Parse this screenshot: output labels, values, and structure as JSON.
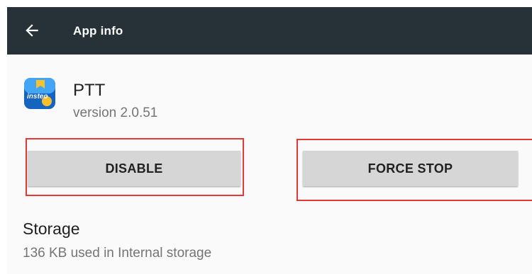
{
  "toolbar": {
    "back_icon": "arrow-left-icon",
    "title": "App info",
    "background": "#263238"
  },
  "app": {
    "icon": "ptt-app-icon",
    "icon_text": "insteo",
    "name": "PTT",
    "version": "version 2.0.51"
  },
  "actions": {
    "disable_label": "DISABLE",
    "force_stop_label": "FORCE STOP",
    "highlight_color": "#e53935"
  },
  "storage": {
    "title": "Storage",
    "summary": "136 KB used in Internal storage"
  }
}
